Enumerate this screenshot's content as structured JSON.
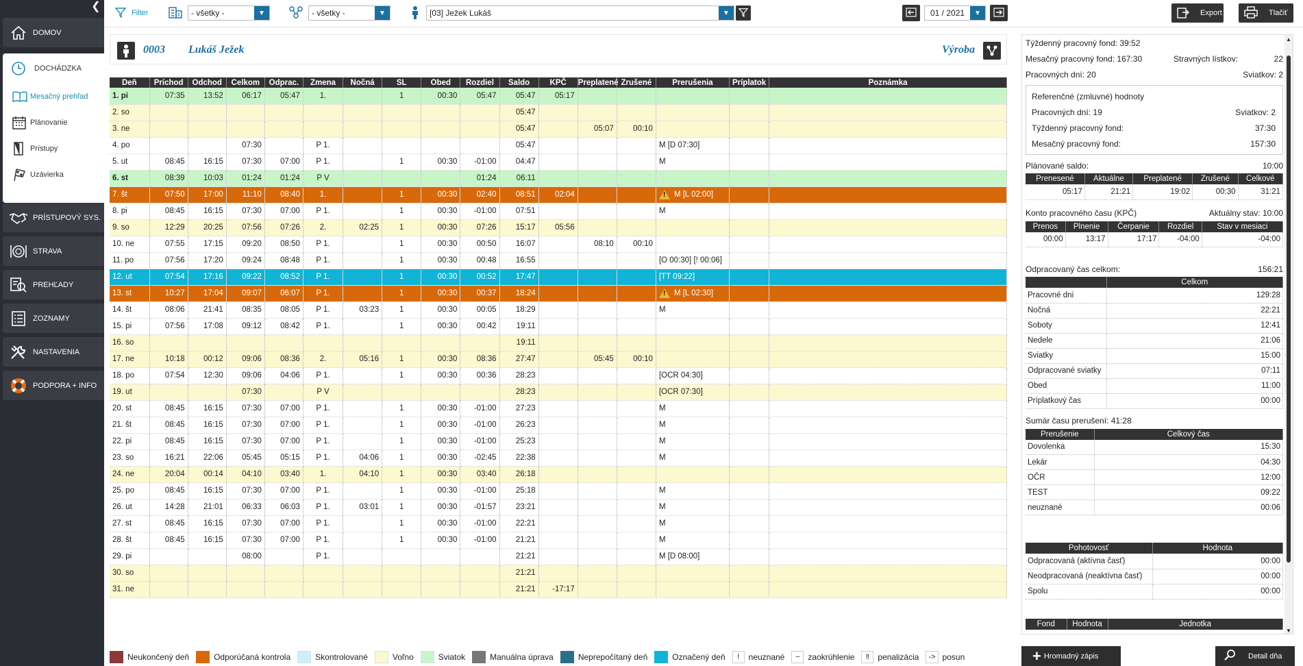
{
  "sidebar": {
    "items": [
      {
        "label": "DOMOV",
        "icon": "home-icon"
      },
      {
        "label": "DOCHÁDZKA",
        "icon": "clock-icon"
      },
      {
        "label": "PRÍSTUPOVÝ SYS.",
        "icon": "handshake-icon"
      },
      {
        "label": "STRAVA",
        "icon": "plate-icon"
      },
      {
        "label": "PREHĽADY",
        "icon": "report-search-icon"
      },
      {
        "label": "ZOZNAMY",
        "icon": "list-icon"
      },
      {
        "label": "NASTAVENIA",
        "icon": "tools-icon"
      },
      {
        "label": "PODPORA + INFO",
        "icon": "lifebuoy-icon"
      }
    ],
    "sub": [
      {
        "label": "Mesačný prehľad",
        "icon": "book-icon"
      },
      {
        "label": "Plánovanie",
        "icon": "calendar-icon"
      },
      {
        "label": "Prístupy",
        "icon": "door-icon"
      },
      {
        "label": "Uzávierka",
        "icon": "flag-icon"
      }
    ]
  },
  "toolbar": {
    "filter_label": "Filter",
    "group1_value": "- všetky -",
    "group2_value": "- všetky -",
    "employee_value": "[03] Ježek Lukáš",
    "period_value": "01 / 2021",
    "export_label": "Export",
    "print_label": "Tlačiť"
  },
  "employee": {
    "id": "0003",
    "name": "Lukáš Ježek",
    "department": "Výroba"
  },
  "table": {
    "headers": [
      "Deň",
      "Príchod",
      "Odchod",
      "Celkom",
      "Odprac.",
      "Zmena",
      "Nočná",
      "SL",
      "Obed",
      "Rozdiel",
      "Saldo",
      "KPČ",
      "Preplatené",
      "Zrušené",
      "Prerušenia",
      "Príplatok",
      "Poznámka"
    ],
    "rows": [
      {
        "style": "green",
        "bold": true,
        "c": [
          "1. pi",
          "07:35",
          "13:52",
          "06:17",
          "05:47",
          "1.",
          "",
          "1",
          "00:30",
          "05:47",
          "05:47",
          "05:17",
          "",
          "",
          "",
          "",
          ""
        ]
      },
      {
        "style": "free",
        "bold": false,
        "c": [
          "2. so",
          "",
          "",
          "",
          "",
          "",
          "",
          "",
          "",
          "",
          "05:47",
          "",
          "",
          "",
          "",
          "",
          ""
        ]
      },
      {
        "style": "free",
        "bold": false,
        "c": [
          "3. ne",
          "",
          "",
          "",
          "",
          "",
          "",
          "",
          "",
          "",
          "05:47",
          "",
          "05:07",
          "00:10",
          "",
          "",
          ""
        ]
      },
      {
        "style": "wk",
        "bold": false,
        "c": [
          "4. po",
          "",
          "",
          "07:30",
          "",
          "P 1.",
          "",
          "",
          "",
          "",
          "05:47",
          "",
          "",
          "",
          "M [D 07:30]",
          "",
          ""
        ]
      },
      {
        "style": "wk",
        "bold": false,
        "c": [
          "5. ut",
          "08:45",
          "16:15",
          "07:30",
          "07:00",
          "P 1.",
          "",
          "1",
          "00:30",
          "-01:00",
          "04:47",
          "",
          "",
          "",
          "M",
          "",
          ""
        ]
      },
      {
        "style": "green",
        "bold": true,
        "c": [
          "6. st",
          "08:39",
          "10:03",
          "01:24",
          "01:24",
          "P V",
          "",
          "",
          "",
          "01:24",
          "06:11",
          "",
          "",
          "",
          "",
          "",
          ""
        ]
      },
      {
        "style": "orange",
        "bold": false,
        "warn": true,
        "c": [
          "7. št",
          "07:50",
          "17:00",
          "11:10",
          "08:40",
          "1.",
          "",
          "1",
          "00:30",
          "02:40",
          "08:51",
          "02:04",
          "",
          "",
          "M [L 02:00]",
          "",
          ""
        ]
      },
      {
        "style": "wk",
        "bold": false,
        "c": [
          "8. pi",
          "08:45",
          "16:15",
          "07:30",
          "07:00",
          "P 1.",
          "",
          "1",
          "00:30",
          "-01:00",
          "07:51",
          "",
          "",
          "",
          "M",
          "",
          ""
        ]
      },
      {
        "style": "free",
        "bold": false,
        "c": [
          "9. so",
          "12:29",
          "20:25",
          "07:56",
          "07:26",
          "2.",
          "02:25",
          "1",
          "00:30",
          "07:26",
          "15:17",
          "05:56",
          "",
          "",
          "",
          "",
          ""
        ]
      },
      {
        "style": "wk",
        "bold": false,
        "c": [
          "10. ne",
          "07:55",
          "17:15",
          "09:20",
          "08:50",
          "P 1.",
          "",
          "1",
          "00:30",
          "00:50",
          "16:07",
          "",
          "08:10",
          "00:10",
          "",
          "",
          ""
        ]
      },
      {
        "style": "wk",
        "bold": false,
        "c": [
          "11. po",
          "07:56",
          "17:20",
          "09:24",
          "08:48",
          "P 1.",
          "",
          "1",
          "00:30",
          "00:48",
          "16:55",
          "",
          "",
          "",
          "[O 00:30] [! 00:06]",
          "",
          ""
        ]
      },
      {
        "style": "cyan",
        "bold": false,
        "c": [
          "12. ut",
          "07:54",
          "17:16",
          "09:22",
          "08:52",
          "P 1.",
          "",
          "1",
          "00:30",
          "00:52",
          "17:47",
          "",
          "",
          "",
          "[TT 09:22]",
          "",
          ""
        ]
      },
      {
        "style": "orange",
        "bold": false,
        "warn": true,
        "c": [
          "13. st",
          "10:27",
          "17:04",
          "09:07",
          "06:07",
          "P 1.",
          "",
          "1",
          "00:30",
          "00:37",
          "18:24",
          "",
          "",
          "",
          "M [L 02:30]",
          "",
          ""
        ]
      },
      {
        "style": "wk",
        "bold": false,
        "c": [
          "14. št",
          "08:06",
          "21:41",
          "08:35",
          "08:05",
          "P 1.",
          "03:23",
          "1",
          "00:30",
          "00:05",
          "18:29",
          "",
          "",
          "",
          "M",
          "",
          ""
        ]
      },
      {
        "style": "wk",
        "bold": false,
        "c": [
          "15. pi",
          "07:56",
          "17:08",
          "09:12",
          "08:42",
          "P 1.",
          "",
          "1",
          "00:30",
          "00:42",
          "19:11",
          "",
          "",
          "",
          "",
          "",
          ""
        ]
      },
      {
        "style": "free",
        "bold": false,
        "c": [
          "16. so",
          "",
          "",
          "",
          "",
          "",
          "",
          "",
          "",
          "",
          "19:11",
          "",
          "",
          "",
          "",
          "",
          ""
        ]
      },
      {
        "style": "free",
        "bold": false,
        "c": [
          "17. ne",
          "10:18",
          "00:12",
          "09:06",
          "08:36",
          "2.",
          "05:16",
          "1",
          "00:30",
          "08:36",
          "27:47",
          "",
          "05:45",
          "00:10",
          "",
          "",
          ""
        ]
      },
      {
        "style": "wk",
        "bold": false,
        "c": [
          "18. po",
          "07:54",
          "12:30",
          "09:06",
          "04:06",
          "P 1.",
          "",
          "1",
          "00:30",
          "00:36",
          "28:23",
          "",
          "",
          "",
          "[OCR 04:30]",
          "",
          ""
        ]
      },
      {
        "style": "free",
        "bold": false,
        "c": [
          "19. ut",
          "",
          "",
          "07:30",
          "",
          "P V",
          "",
          "",
          "",
          "",
          "28:23",
          "",
          "",
          "",
          "[OCR 07:30]",
          "",
          ""
        ]
      },
      {
        "style": "wk",
        "bold": false,
        "c": [
          "20. st",
          "08:45",
          "16:15",
          "07:30",
          "07:00",
          "P 1.",
          "",
          "1",
          "00:30",
          "-01:00",
          "27:23",
          "",
          "",
          "",
          "M",
          "",
          ""
        ]
      },
      {
        "style": "wk",
        "bold": false,
        "c": [
          "21. št",
          "08:45",
          "16:15",
          "07:30",
          "07:00",
          "P 1.",
          "",
          "1",
          "00:30",
          "-01:00",
          "26:23",
          "",
          "",
          "",
          "M",
          "",
          ""
        ]
      },
      {
        "style": "wk",
        "bold": false,
        "c": [
          "22. pi",
          "08:45",
          "16:15",
          "07:30",
          "07:00",
          "P 1.",
          "",
          "1",
          "00:30",
          "-01:00",
          "25:23",
          "",
          "",
          "",
          "M",
          "",
          ""
        ]
      },
      {
        "style": "wk",
        "bold": false,
        "c": [
          "23. so",
          "16:21",
          "22:06",
          "05:45",
          "05:15",
          "P 1.",
          "04:06",
          "1",
          "00:30",
          "-02:45",
          "22:38",
          "",
          "",
          "",
          "M",
          "",
          ""
        ]
      },
      {
        "style": "free",
        "bold": false,
        "c": [
          "24. ne",
          "20:04",
          "00:14",
          "04:10",
          "03:40",
          "1.",
          "04:10",
          "1",
          "00:30",
          "03:40",
          "26:18",
          "",
          "",
          "",
          "",
          "",
          ""
        ]
      },
      {
        "style": "wk",
        "bold": false,
        "c": [
          "25. po",
          "08:45",
          "16:15",
          "07:30",
          "07:00",
          "P 1.",
          "",
          "1",
          "00:30",
          "-01:00",
          "25:18",
          "",
          "",
          "",
          "M",
          "",
          ""
        ]
      },
      {
        "style": "wk",
        "bold": false,
        "c": [
          "26. ut",
          "14:28",
          "21:01",
          "06:33",
          "06:03",
          "P 1.",
          "03:01",
          "1",
          "00:30",
          "-01:57",
          "23:21",
          "",
          "",
          "",
          "M",
          "",
          ""
        ]
      },
      {
        "style": "wk",
        "bold": false,
        "c": [
          "27. st",
          "08:45",
          "16:15",
          "07:30",
          "07:00",
          "P 1.",
          "",
          "1",
          "00:30",
          "-01:00",
          "22:21",
          "",
          "",
          "",
          "M",
          "",
          ""
        ]
      },
      {
        "style": "wk",
        "bold": false,
        "c": [
          "28. št",
          "08:45",
          "16:15",
          "07:30",
          "07:00",
          "P 1.",
          "",
          "1",
          "00:30",
          "-01:00",
          "21:21",
          "",
          "",
          "",
          "M",
          "",
          ""
        ]
      },
      {
        "style": "wk",
        "bold": false,
        "c": [
          "29. pi",
          "",
          "",
          "08:00",
          "",
          "P 1.",
          "",
          "",
          "",
          "",
          "21:21",
          "",
          "",
          "",
          "M [D 08:00]",
          "",
          ""
        ]
      },
      {
        "style": "free",
        "bold": false,
        "c": [
          "30. so",
          "",
          "",
          "",
          "",
          "",
          "",
          "",
          "",
          "",
          "21:21",
          "",
          "",
          "",
          "",
          "",
          ""
        ]
      },
      {
        "style": "free",
        "bold": false,
        "c": [
          "31. ne",
          "",
          "",
          "",
          "",
          "",
          "",
          "",
          "",
          "",
          "21:21",
          "-17:17",
          "",
          "",
          "",
          "",
          ""
        ]
      }
    ]
  },
  "legend": [
    {
      "type": "swatch",
      "color": "#8b3a3a",
      "label": "Neukončený deň"
    },
    {
      "type": "swatch",
      "color": "#d7690a",
      "label": "Odporúčaná kontrola"
    },
    {
      "type": "swatch",
      "color": "#cfeefb",
      "label": "Skontrolované"
    },
    {
      "type": "swatch",
      "color": "#fcf8cf",
      "label": "Voľno"
    },
    {
      "type": "swatch",
      "color": "#c8f5c8",
      "label": "Sviatok"
    },
    {
      "type": "swatch",
      "color": "#777777",
      "label": "Manuálna úprava"
    },
    {
      "type": "swatch",
      "color": "#2c6e8a",
      "label": "Neprepočítaný deň"
    },
    {
      "type": "swatch",
      "color": "#11b4d6",
      "label": "Označený deň"
    },
    {
      "type": "key",
      "key": "!",
      "label": "neuznané"
    },
    {
      "type": "key",
      "key": "~",
      "label": "zaokrúhlenie"
    },
    {
      "type": "key",
      "key": "‼",
      "label": "penalizácia"
    },
    {
      "type": "key",
      "key": "->",
      "label": "posun"
    }
  ],
  "panel": {
    "weekly_fund_label": "Týždenný pracovný fond:",
    "weekly_fund_value": "39:52",
    "monthly_fund_label": "Mesačný pracovný fond:",
    "monthly_fund_value": "167:30",
    "meal_label": "Stravných lístkov:",
    "meal_value": "22",
    "workdays_label": "Pracovných dní:",
    "workdays_value": "20",
    "holidays_label": "Sviatkov:",
    "holidays_value": "2",
    "ref_title": "Referenčné (zmluvné) hodnoty",
    "ref_workdays_label": "Pracovných dní:",
    "ref_workdays_value": "19",
    "ref_holidays_label": "Sviatkov:",
    "ref_holidays_value": "2",
    "ref_weekly_label": "Týždenný pracovný fond:",
    "ref_weekly_value": "37:30",
    "ref_monthly_label": "Mesačný pracovný fond:",
    "ref_monthly_value": "157:30",
    "planned_label": "Plánované saldo:",
    "planned_value": "10:00",
    "saldo_headers": [
      "Prenesené",
      "Aktuálne",
      "Preplatené",
      "Zrušené",
      "Celkové"
    ],
    "saldo_values": [
      "05:17",
      "21:21",
      "19:02",
      "00:30",
      "31:21"
    ],
    "kpc_label": "Konto pracovného času (KPČ)",
    "kpc_state_label": "Aktuálny stav:",
    "kpc_state_value": "10:00",
    "kpc_headers": [
      "Prenos",
      "Plnenie",
      "Čerpanie",
      "Rozdiel",
      "Stav v mesiaci"
    ],
    "kpc_values": [
      "00:00",
      "13:17",
      "17:17",
      "-04:00",
      "-04:00"
    ],
    "worked_label": "Odpracovaný čas celkom:",
    "worked_value": "156:21",
    "worked_header": "Celkom",
    "worked_rows": [
      {
        "k": "Pracovné dni",
        "v": "129:28"
      },
      {
        "k": "Nočná",
        "v": "22:21"
      },
      {
        "k": "Soboty",
        "v": "12:41"
      },
      {
        "k": "Nedele",
        "v": "21:06"
      },
      {
        "k": "Sviatky",
        "v": "15:00"
      },
      {
        "k": "Odpracované sviatky",
        "v": "07:11"
      },
      {
        "k": "Obed",
        "v": "11:00"
      },
      {
        "k": "Príplatkový čas",
        "v": "00:00"
      }
    ],
    "interrupt_label": "Sumár času prerušení:",
    "interrupt_value": "41:28",
    "interrupt_headers": [
      "Prerušenie",
      "Celkový čas"
    ],
    "interrupt_rows": [
      {
        "k": "Dovolenka",
        "v": "15:30"
      },
      {
        "k": "Lekár",
        "v": "04:30"
      },
      {
        "k": "OČR",
        "v": "12:00"
      },
      {
        "k": "TEST",
        "v": "09:22"
      },
      {
        "k": "neuznané",
        "v": "00:06"
      }
    ],
    "standby_headers": [
      "Pohotovosť",
      "Hodnota"
    ],
    "standby_rows": [
      {
        "k": "Odpracovaná (aktívna časť)",
        "v": "00:00"
      },
      {
        "k": "Neodpracovaná (neaktívna časť)",
        "v": "00:00"
      },
      {
        "k": "Spolu",
        "v": "00:00"
      }
    ],
    "fund_headers": [
      "Fond",
      "Hodnota",
      "Jednotka"
    ]
  },
  "buttons": {
    "bulk_label": "Hromadný zápis",
    "detail_label": "Detail dňa"
  }
}
